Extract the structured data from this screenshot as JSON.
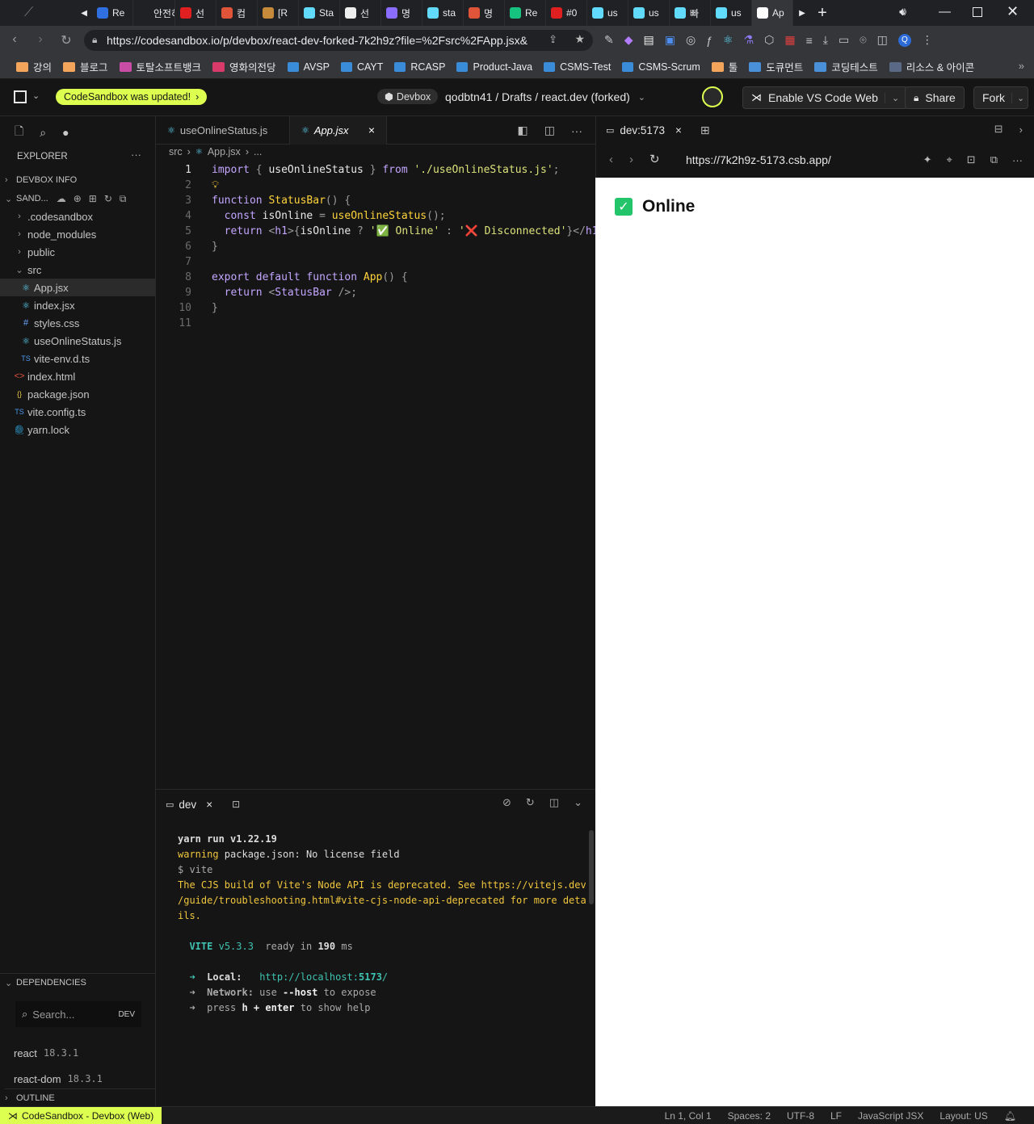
{
  "browser": {
    "tabs": [
      {
        "label": "Re",
        "color": "#2f6fe0"
      },
      {
        "label": "안전하",
        "color": "#202124"
      },
      {
        "label": "선",
        "color": "#e02020"
      },
      {
        "label": "컴",
        "color": "#e0553a"
      },
      {
        "label": "[R",
        "color": "#c58a3a"
      },
      {
        "label": "Sta",
        "color": "#61dafb"
      },
      {
        "label": "선",
        "color": "#eeeeee"
      },
      {
        "label": "명",
        "color": "#8a6cff"
      },
      {
        "label": "sta",
        "color": "#61dafb"
      },
      {
        "label": "명",
        "color": "#e0553a"
      },
      {
        "label": "Re",
        "color": "#16c47f"
      },
      {
        "label": "#0",
        "color": "#e02020"
      },
      {
        "label": "us",
        "color": "#61dafb"
      },
      {
        "label": "us",
        "color": "#61dafb"
      },
      {
        "label": "빠",
        "color": "#61dafb"
      },
      {
        "label": "us",
        "color": "#61dafb"
      },
      {
        "label": "Ap",
        "color": "#ffffff"
      }
    ],
    "url": "https://codesandbox.io/p/devbox/react-dev-forked-7k2h9z?file=%2Fsrc%2FApp.jsx&",
    "bookmarks": [
      {
        "label": "강의",
        "icon": "folder"
      },
      {
        "label": "블로그",
        "icon": "folder"
      },
      {
        "label": "토탈소프트뱅크",
        "icon": "folder-pink"
      },
      {
        "label": "영화의전당",
        "icon": "flag"
      },
      {
        "label": "AVSP",
        "icon": "azure"
      },
      {
        "label": "CAYT",
        "icon": "azure"
      },
      {
        "label": "RCASP",
        "icon": "azure"
      },
      {
        "label": "Product-Java",
        "icon": "azure"
      },
      {
        "label": "CSMS-Test",
        "icon": "azure"
      },
      {
        "label": "CSMS-Scrum",
        "icon": "azure"
      },
      {
        "label": "툴",
        "icon": "folder"
      },
      {
        "label": "도큐먼트",
        "icon": "folder-blue"
      },
      {
        "label": "코딩테스트",
        "icon": "folder-blue"
      },
      {
        "label": "리소스 & 아이콘",
        "icon": "folder-dark"
      }
    ]
  },
  "header": {
    "updated_pill": "CodeSandbox was updated!",
    "devbox_badge": "Devbox",
    "breadcrumb": "qodbtn41 / Drafts / react.dev (forked)",
    "vscode_button": "Enable VS Code Web",
    "share_button": "Share",
    "fork_button": "Fork"
  },
  "sidebar": {
    "explorer_title": "EXPLORER",
    "devbox_info": "DEVBOX INFO",
    "sandbox_section": "SAND...",
    "files": [
      {
        "label": ".codesandbox",
        "type": "folder",
        "indent": 1
      },
      {
        "label": "node_modules",
        "type": "folder",
        "indent": 1
      },
      {
        "label": "public",
        "type": "folder",
        "indent": 1
      },
      {
        "label": "src",
        "type": "folder-open",
        "indent": 1
      },
      {
        "label": "App.jsx",
        "type": "react",
        "indent": 2,
        "selected": true
      },
      {
        "label": "index.jsx",
        "type": "react",
        "indent": 2
      },
      {
        "label": "styles.css",
        "type": "css",
        "indent": 2
      },
      {
        "label": "useOnlineStatus.js",
        "type": "react",
        "indent": 2
      },
      {
        "label": "vite-env.d.ts",
        "type": "ts",
        "indent": 2
      },
      {
        "label": "index.html",
        "type": "html",
        "indent": 1
      },
      {
        "label": "package.json",
        "type": "json",
        "indent": 1
      },
      {
        "label": "vite.config.ts",
        "type": "ts",
        "indent": 1
      },
      {
        "label": "yarn.lock",
        "type": "yarn",
        "indent": 1
      }
    ],
    "dependencies_title": "DEPENDENCIES",
    "search_placeholder": "Search...",
    "search_tag": "DEV",
    "dependencies": [
      {
        "name": "react",
        "version": "18.3.1"
      },
      {
        "name": "react-dom",
        "version": "18.3.1"
      }
    ],
    "outline_title": "OUTLINE"
  },
  "editor": {
    "tabs": [
      "useOnlineStatus.js",
      "App.jsx"
    ],
    "breadcrumb_dir": "src",
    "breadcrumb_file": "App.jsx",
    "breadcrumb_more": "...",
    "line_numbers": [
      "1",
      "2",
      "3",
      "4",
      "5",
      "6",
      "7",
      "8",
      "9",
      "10",
      "11"
    ]
  },
  "terminal": {
    "tab_label": "dev",
    "lines": [
      "yarn run v1.22.19",
      "warning package.json: No license field",
      "$ vite",
      "The CJS build of Vite's Node API is deprecated. See https://vitejs.dev",
      "/guide/troubleshooting.html#vite-cjs-node-api-deprecated for more deta",
      "ils.",
      "",
      "  VITE v5.3.3  ready in 190 ms",
      "",
      "  ➜  Local:   http://localhost:5173/",
      "  ➜  Network: use --host to expose",
      "  ➜  press h + enter to show help"
    ]
  },
  "preview": {
    "tab_label": "dev:5173",
    "url": "https://7k2h9z-5173.csb.app/",
    "heading": "Online"
  },
  "status": {
    "left": "CodeSandbox - Devbox (Web)",
    "position": "Ln 1, Col 1",
    "spaces": "Spaces: 2",
    "encoding": "UTF-8",
    "eol": "LF",
    "language": "JavaScript JSX",
    "layout": "Layout: US"
  },
  "colors": {
    "accent": "#dcff50",
    "check_green": "#24c46a",
    "error_red": "#e0443b"
  }
}
